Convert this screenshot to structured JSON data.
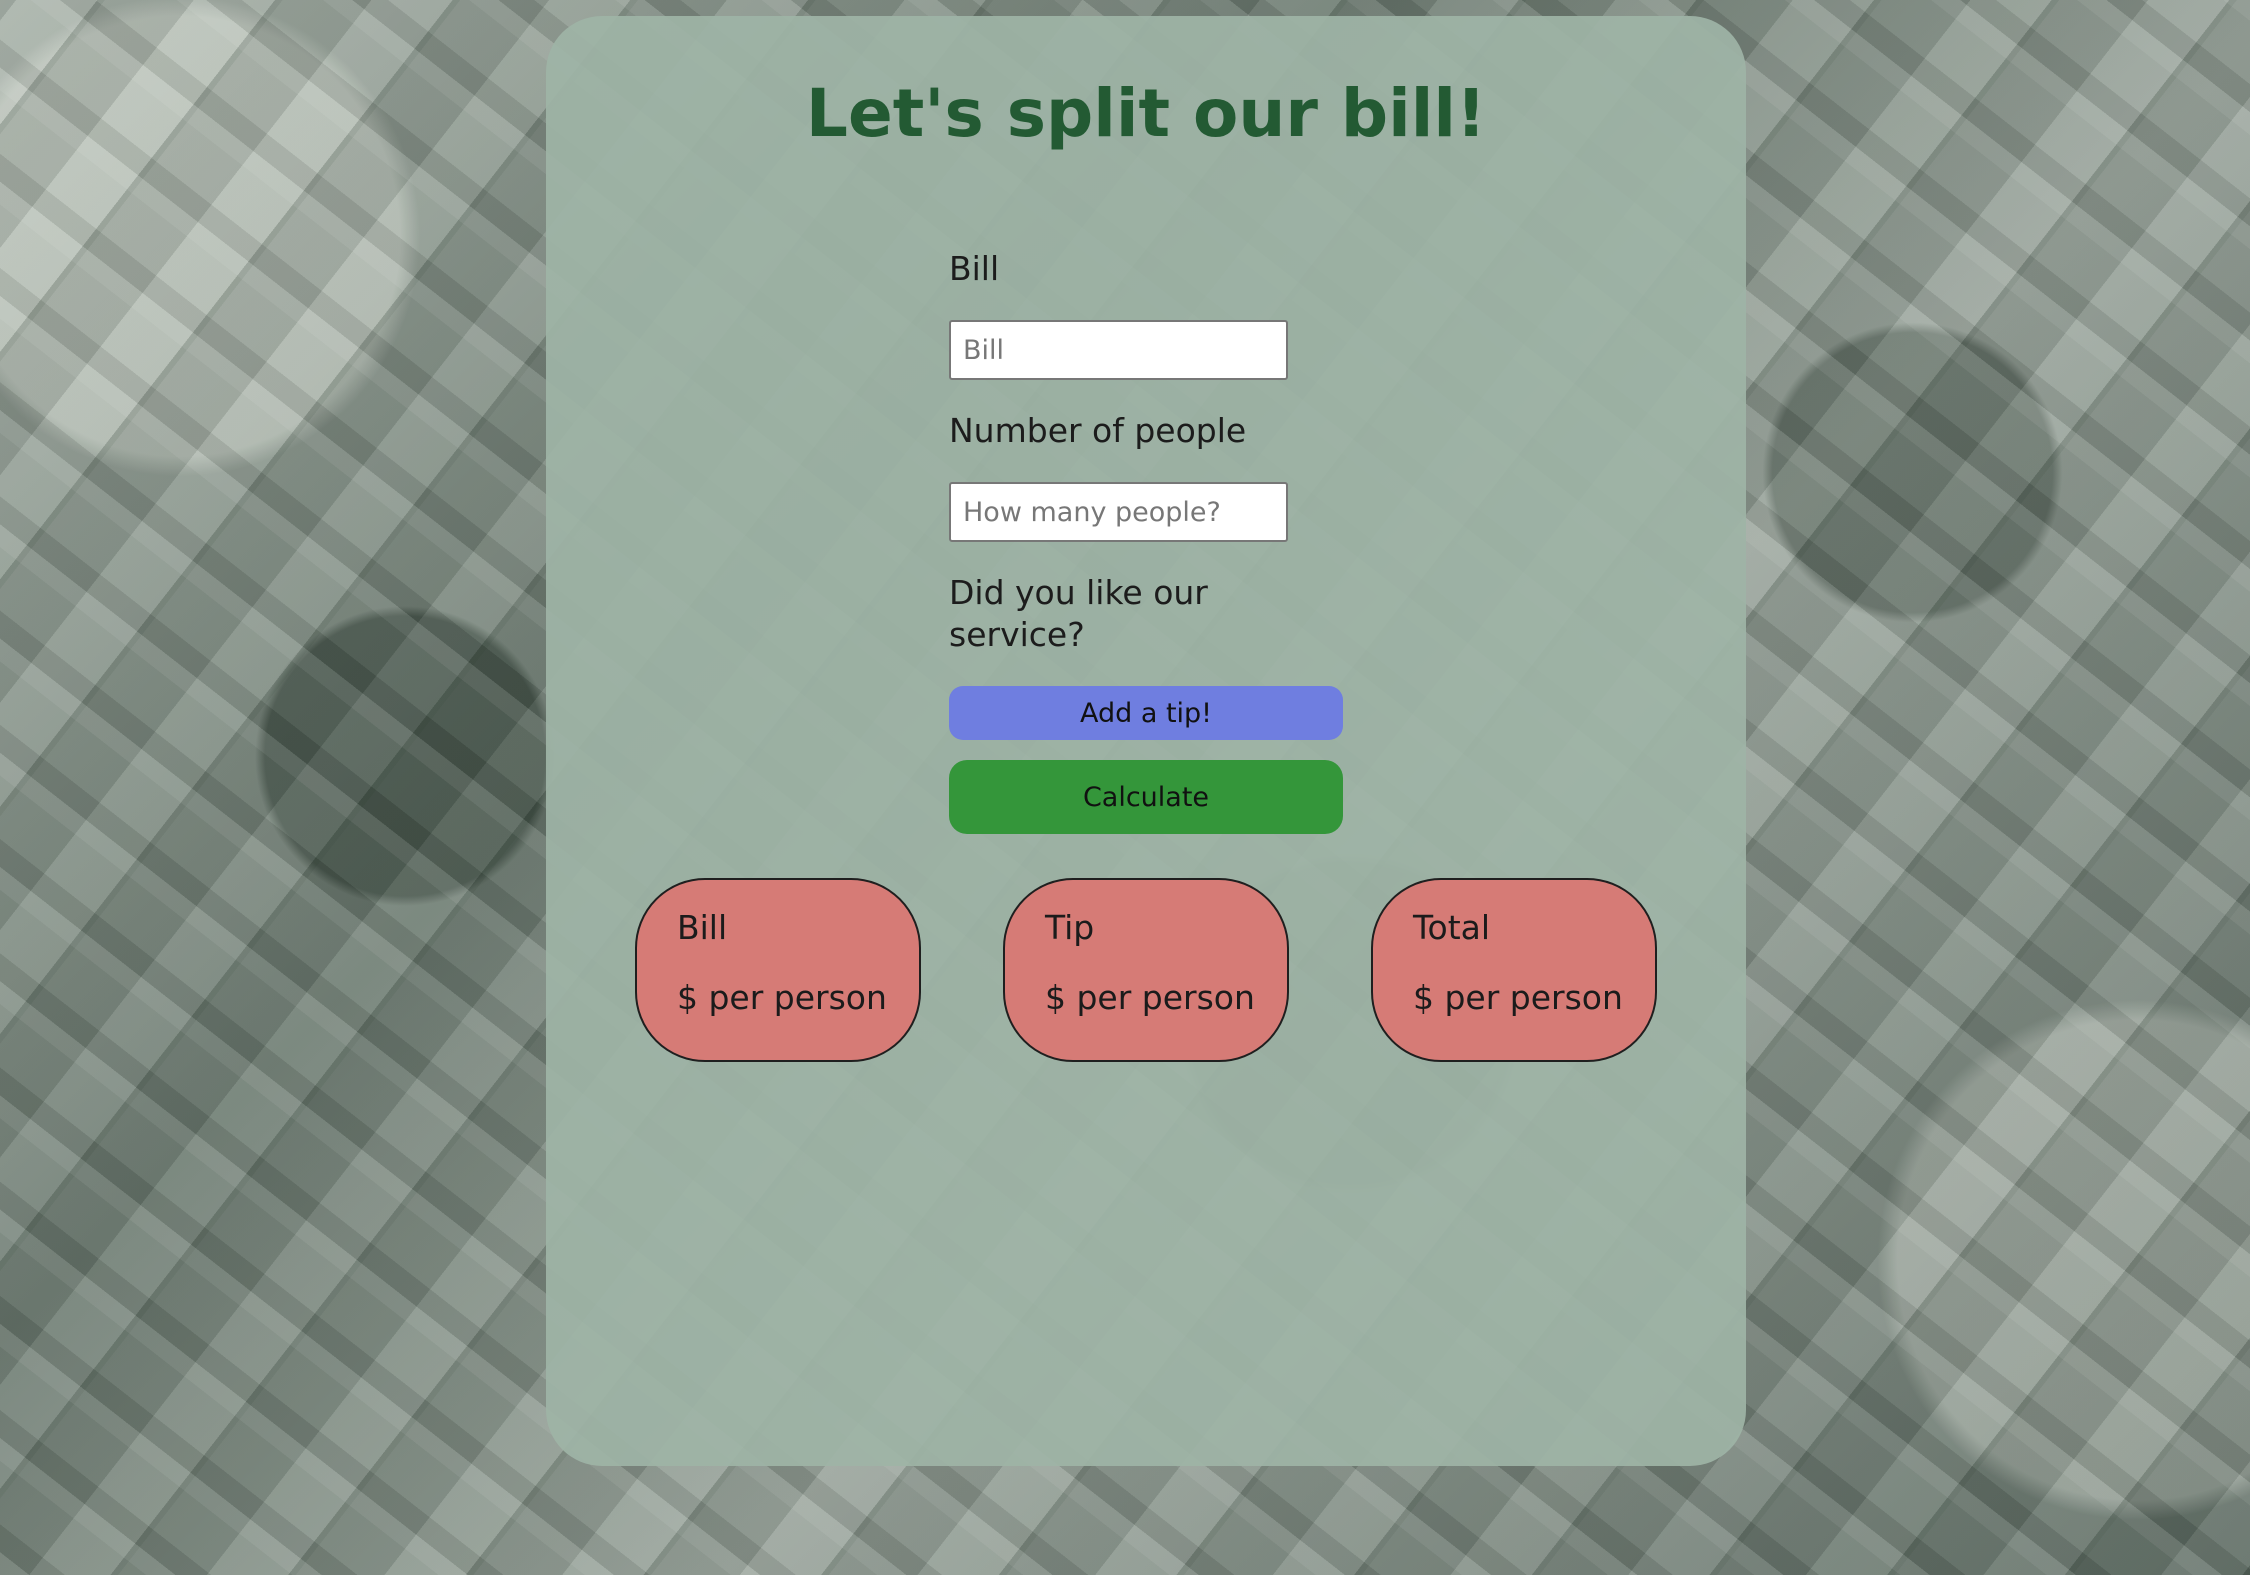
{
  "page": {
    "title": "Let's split our bill!"
  },
  "form": {
    "bill_label": "Bill",
    "bill_placeholder": "Bill",
    "bill_value": "",
    "people_label": "Number of people",
    "people_placeholder": "How many people?",
    "people_value": "",
    "service_question": "Did you like our service?",
    "tip_button_label": "Add a tip!",
    "calculate_button_label": "Calculate"
  },
  "results": [
    {
      "label": "Bill",
      "value": "$ per person"
    },
    {
      "label": "Tip",
      "value": "$ per person"
    },
    {
      "label": "Total",
      "value": "$ per person"
    }
  ],
  "colors": {
    "title": "#235a33",
    "card": "#9eb4a6",
    "tip_button": "#6f7ee0",
    "calculate_button": "#34963a",
    "result_box": "#d67b76"
  },
  "background": {
    "image": "dollar-bills-background"
  }
}
